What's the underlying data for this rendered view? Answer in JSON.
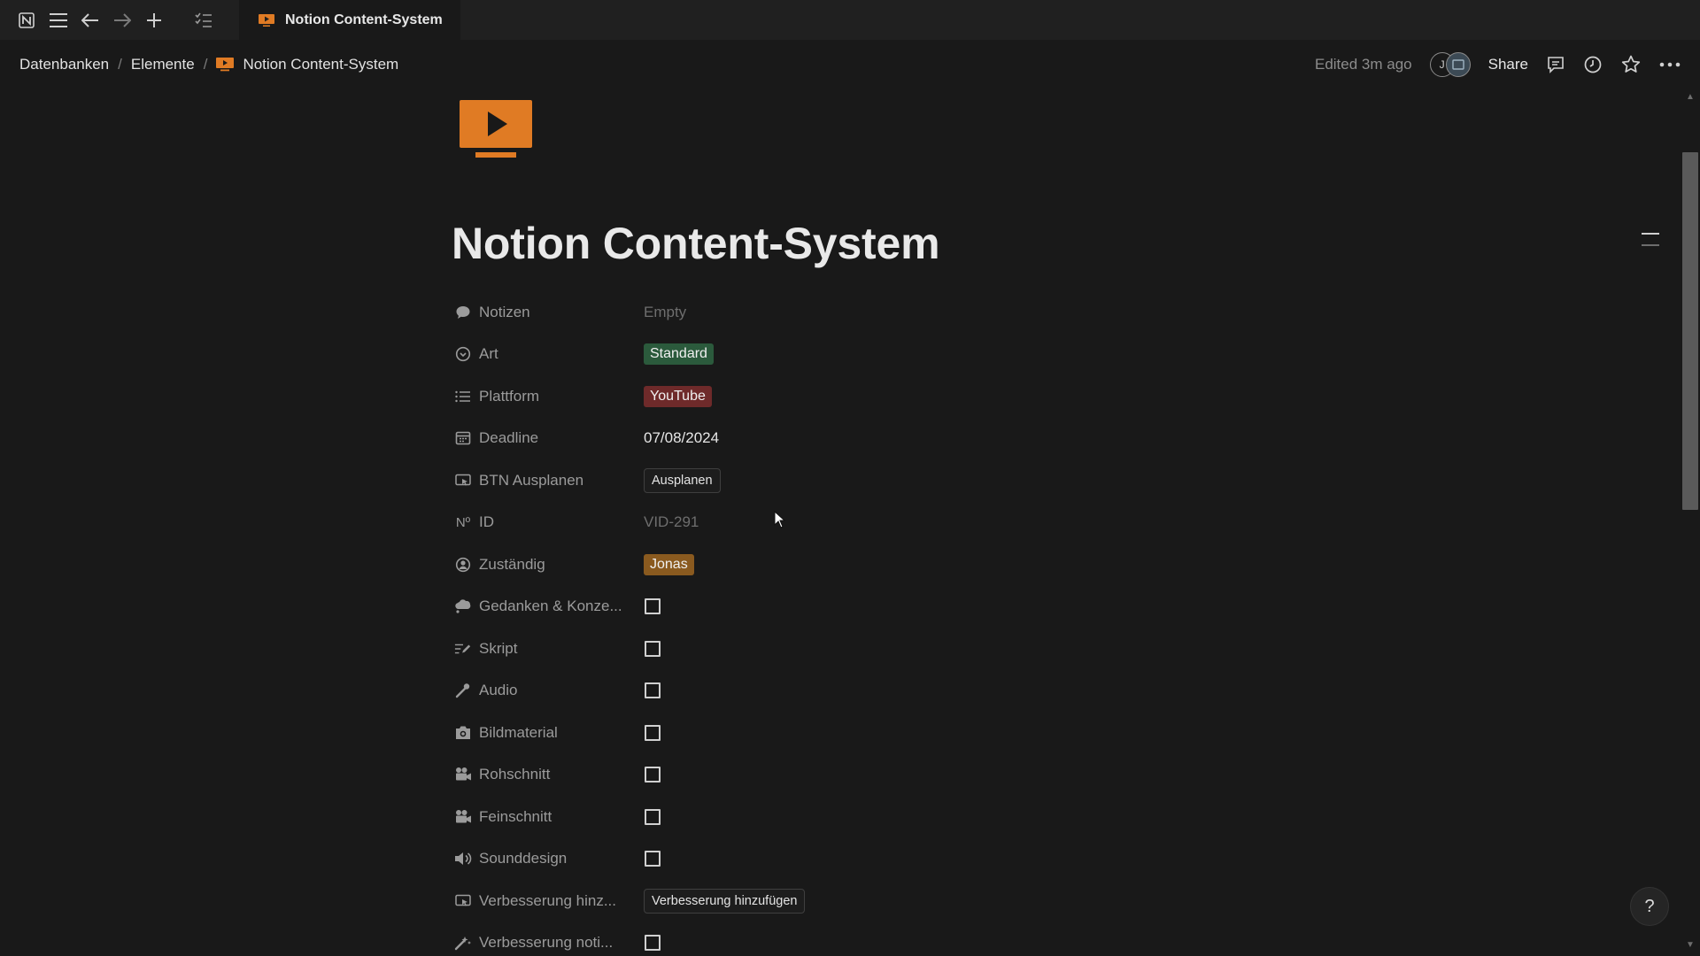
{
  "tab": {
    "title": "Notion Content-System"
  },
  "breadcrumb": {
    "items": [
      "Datenbanken",
      "Elemente"
    ],
    "current": "Notion Content-System",
    "separator": "/"
  },
  "header": {
    "edited": "Edited 3m ago",
    "avatar_initial": "J",
    "share_label": "Share"
  },
  "page": {
    "title": "Notion Content-System",
    "icon": "video-play-icon"
  },
  "properties": [
    {
      "name": "Notizen",
      "icon": "comment-icon",
      "value": "Empty",
      "kind": "empty"
    },
    {
      "name": "Art",
      "icon": "status-icon",
      "value": "Standard",
      "kind": "tag",
      "color": "#2b5a3c"
    },
    {
      "name": "Plattform",
      "icon": "list-icon",
      "value": "YouTube",
      "kind": "tag",
      "color": "#6e2a2a"
    },
    {
      "name": "Deadline",
      "icon": "calendar-icon",
      "value": "07/08/2024",
      "kind": "text"
    },
    {
      "name": "BTN Ausplanen",
      "icon": "button-cursor-icon",
      "value": "Ausplanen",
      "kind": "button"
    },
    {
      "name": "ID",
      "icon": "number-icon",
      "value": "VID-291",
      "kind": "id"
    },
    {
      "name": "Zuständig",
      "icon": "person-icon",
      "value": "Jonas",
      "kind": "tag",
      "color": "#8a5a1f"
    },
    {
      "name": "Gedanken & Konze...",
      "icon": "thought-bubble-icon",
      "value": false,
      "kind": "checkbox"
    },
    {
      "name": "Skript",
      "icon": "script-pen-icon",
      "value": false,
      "kind": "checkbox"
    },
    {
      "name": "Audio",
      "icon": "microphone-icon",
      "value": false,
      "kind": "checkbox"
    },
    {
      "name": "Bildmaterial",
      "icon": "camera-icon",
      "value": false,
      "kind": "checkbox"
    },
    {
      "name": "Rohschnitt",
      "icon": "video-camera-icon",
      "value": false,
      "kind": "checkbox"
    },
    {
      "name": "Feinschnitt",
      "icon": "video-camera-icon",
      "value": false,
      "kind": "checkbox"
    },
    {
      "name": "Sounddesign",
      "icon": "speaker-icon",
      "value": false,
      "kind": "checkbox"
    },
    {
      "name": "Verbesserung hinz...",
      "icon": "button-cursor-icon",
      "value": "Verbesserung hinzufügen",
      "kind": "button"
    },
    {
      "name": "Verbesserung noti...",
      "icon": "magic-wand-icon",
      "value": false,
      "kind": "checkbox"
    }
  ],
  "help_label": "?",
  "colors": {
    "accent_icon": "#e07b24",
    "background": "#191919"
  }
}
